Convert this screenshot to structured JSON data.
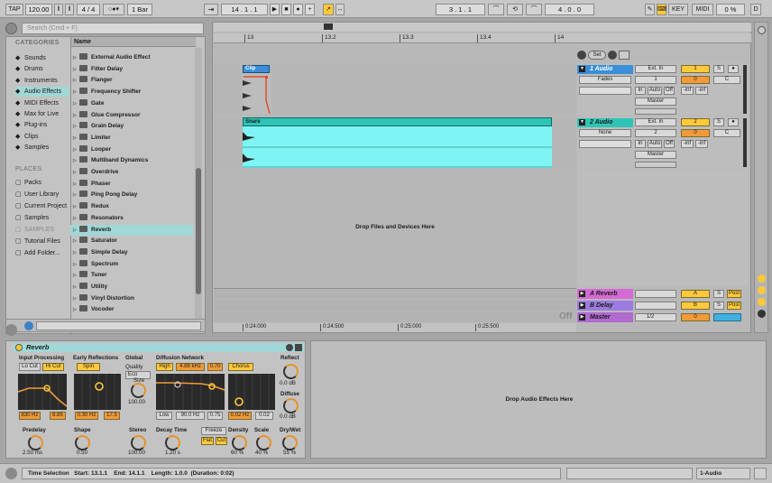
{
  "toolbar": {
    "tap": "TAP",
    "tempo": "120.00",
    "signature": "4 / 4",
    "quantize": "1 Bar",
    "position": "14 .  1 .  1",
    "loop_start": "3 .  1 .  1",
    "loop_length": "4 .  0 .  0",
    "key": "KEY",
    "midi": "MIDI",
    "cpu": "0 %",
    "disk": "D"
  },
  "browser": {
    "search_placeholder": "Search (Cmd + F)",
    "categories_header": "CATEGORIES",
    "categories": [
      {
        "label": "Sounds",
        "icon": "note-icon"
      },
      {
        "label": "Drums",
        "icon": "grid-icon"
      },
      {
        "label": "Instruments",
        "icon": "wave-icon"
      },
      {
        "label": "Audio Effects",
        "icon": "effects-icon"
      },
      {
        "label": "MIDI Effects",
        "icon": "midi-icon"
      },
      {
        "label": "Max for Live",
        "icon": "max-icon"
      },
      {
        "label": "Plug-ins",
        "icon": "plug-icon"
      },
      {
        "label": "Clips",
        "icon": "play-icon"
      },
      {
        "label": "Samples",
        "icon": "sample-icon"
      }
    ],
    "places_header": "PLACES",
    "places": [
      {
        "label": "Packs"
      },
      {
        "label": "User Library"
      },
      {
        "label": "Current Project"
      },
      {
        "label": "Samples"
      },
      {
        "label": "SAMPLES"
      },
      {
        "label": "Tutorial Files"
      },
      {
        "label": "Add Folder..."
      }
    ],
    "name_header": "Name",
    "items": [
      "External Audio Effect",
      "Filter Delay",
      "Flanger",
      "Frequency Shifter",
      "Gate",
      "Glue Compressor",
      "Grain Delay",
      "Limiter",
      "Looper",
      "Multiband Dynamics",
      "Overdrive",
      "Phaser",
      "Ping Pong Delay",
      "Redux",
      "Resonators",
      "Reverb",
      "Saturator",
      "Simple Delay",
      "Spectrum",
      "Tuner",
      "Utility",
      "Vinyl Distortion",
      "Vocoder"
    ],
    "selected_item": "Reverb"
  },
  "arrangement": {
    "ruler": [
      "13",
      "13.2",
      "13.3",
      "13.4",
      "14"
    ],
    "time_ruler": [
      "0:24:000",
      "0:24:500",
      "0:25:000",
      "0:25:500"
    ],
    "drop_text": "Drop Files and Devices Here",
    "off_label": "Off",
    "set_label": "Set",
    "tracks": [
      {
        "name": "1 Audio",
        "clip": "Clip",
        "input": "Ext. In",
        "channel": "1",
        "monitor": "Fades",
        "output": "Master",
        "number": "1",
        "vol": "0",
        "pan": "C",
        "inf1": "-inf",
        "inf2": "-inf",
        "mon_in": "In",
        "mon_auto": "Auto",
        "mon_off": "Off"
      },
      {
        "name": "2 Audio",
        "clip": "Snare",
        "input": "Ext. In",
        "channel": "2",
        "monitor": "None",
        "output": "Master",
        "number": "2",
        "vol": "0",
        "pan": "C",
        "inf1": "-inf",
        "inf2": "-inf",
        "mon_in": "In",
        "mon_auto": "Auto",
        "mon_off": "Off"
      }
    ],
    "returns": [
      {
        "name": "A Reverb",
        "letter": "A"
      },
      {
        "name": "B Delay",
        "letter": "B"
      }
    ],
    "master": {
      "name": "Master",
      "cue": "1/2",
      "vol": "0"
    },
    "solo": "S",
    "post": "Post"
  },
  "device": {
    "title": "Reverb",
    "input_processing": "Input Processing",
    "lo_cut": "Lo Cut",
    "hi_cut": "Hi Cut",
    "early_reflections": "Early Reflections",
    "spin": "Spin",
    "global": "Global",
    "quality": "Quality",
    "eco": "Eco",
    "size_label": "Size",
    "size_val": "100.00",
    "diffusion_network": "Diffusion Network",
    "high": "High",
    "high_freq": "4.88 kHz",
    "high_val": "0.70",
    "chorus": "Chorus",
    "reflect": "Reflect",
    "reflect_val": "0.0 dB",
    "diffuse": "Diffuse",
    "diffuse_val": "0.0 dB",
    "in_freq1": "830 Hz",
    "in_q": "6.85",
    "er_freq": "0.30 Hz",
    "er_amt": "17.5",
    "low": "Low",
    "low_freq": "90.0 Hz",
    "low_val": "0.75",
    "ch_freq": "0.02 Hz",
    "ch_amt": "0.02",
    "predelay": "Predelay",
    "predelay_val": "2.50 ms",
    "shape": "Shape",
    "shape_val": "0.50",
    "stereo": "Stereo",
    "stereo_val": "100.00",
    "decay": "Decay Time",
    "decay_val": "1.20 s",
    "freeze": "Freeze",
    "flat": "Flat",
    "cut": "Cut",
    "density": "Density",
    "density_val": "60 %",
    "scale": "Scale",
    "scale_val": "40 %",
    "drywet": "Dry/Wet",
    "drywet_val": "55 %",
    "drop_audio": "Drop Audio Effects Here"
  },
  "status": {
    "text": "Time Selection   Start: 13.1.1    End: 14.1.1    Length: 1.0.0  (Duration: 0:02)",
    "track": "1-Audio"
  }
}
